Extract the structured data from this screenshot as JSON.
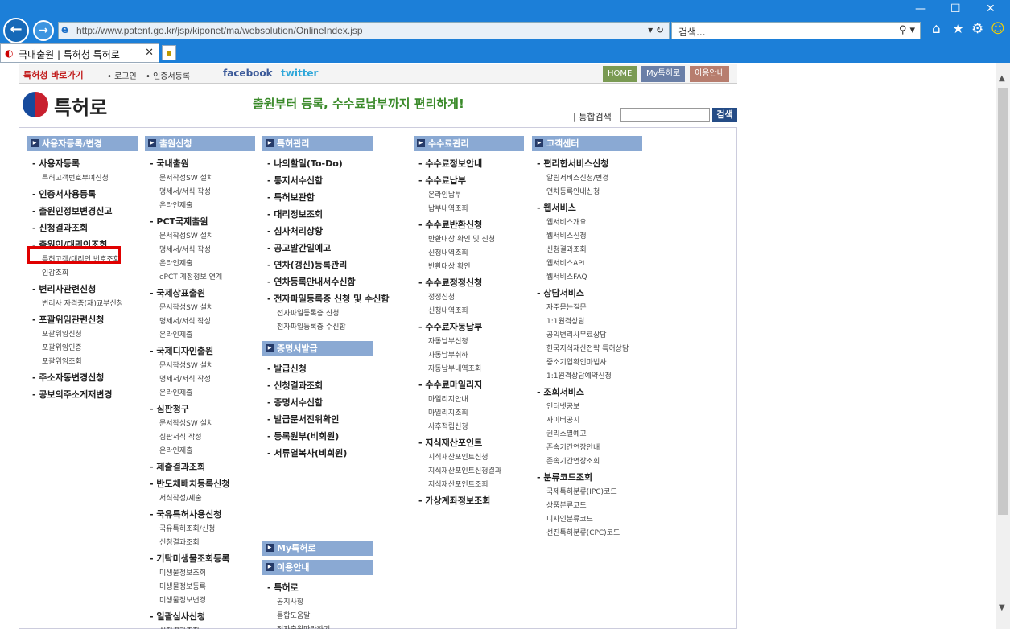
{
  "browser": {
    "address": "http://www.patent.go.kr/jsp/kiponet/ma/websolution/OnlineIndex.jsp",
    "search_placeholder": "검색...",
    "tab_title": "국내출원 | 특허청 특허로"
  },
  "topbar": {
    "shortcut": "특허청 바로가기",
    "login": "로그인",
    "cert": "인증서등록",
    "facebook": "facebook",
    "twitter": "twitter",
    "home_btn": "HOME",
    "my_btn": "My특허로",
    "info_btn": "이용안내"
  },
  "header": {
    "logo": "특허로",
    "slogan": "출원부터 등록, 수수료납부까지 편리하게!",
    "integrated_search": "통합검색",
    "search_btn": "검색"
  },
  "columns": [
    {
      "sections": [
        {
          "title": "사용자등록/변경",
          "items": [
            {
              "label": "사용자등록",
              "sub": [
                "특허고객번호부여신청"
              ]
            },
            {
              "label": "인증서사용등록",
              "sub": []
            },
            {
              "label": "출원인정보변경신고",
              "sub": []
            },
            {
              "label": "신청결과조회",
              "sub": []
            },
            {
              "label": "출원인/대리인조회",
              "sub": [
                "특허고객/대리인 번호조회",
                "인감조회"
              ]
            },
            {
              "label": "변리사관련신청",
              "sub": [
                "변리사 자격증(재)교부신청"
              ]
            },
            {
              "label": "포괄위임관련신청",
              "sub": [
                "포괄위임신청",
                "포괄위임인증",
                "포괄위임조회"
              ]
            },
            {
              "label": "주소자동변경신청",
              "sub": []
            },
            {
              "label": "공보의주소게재변경",
              "sub": []
            }
          ]
        }
      ]
    },
    {
      "sections": [
        {
          "title": "출원신청",
          "items": [
            {
              "label": "국내출원",
              "sub": [
                "문서작성SW 설치",
                "명세서/서식 작성",
                "온라인제출"
              ]
            },
            {
              "label": "PCT국제출원",
              "sub": [
                "문서작성SW 설치",
                "명세서/서식 작성",
                "온라인제출",
                "ePCT 계정정보 연계"
              ]
            },
            {
              "label": "국제상표출원",
              "sub": [
                "문서작성SW 설치",
                "명세서/서식 작성",
                "온라인제출"
              ]
            },
            {
              "label": "국제디자인출원",
              "sub": [
                "문서작성SW 설치",
                "명세서/서식 작성",
                "온라인제출"
              ]
            },
            {
              "label": "심판청구",
              "sub": [
                "문서작성SW 설치",
                "심판서식 작성",
                "온라인제출"
              ]
            },
            {
              "label": "제출결과조회",
              "sub": []
            },
            {
              "label": "반도체배치등록신청",
              "sub": [
                "서식작성/제출"
              ]
            },
            {
              "label": "국유특허사용신청",
              "sub": [
                "국유특허조회/신청",
                "신청결과조회"
              ]
            },
            {
              "label": "기탁미생물조회등록",
              "sub": [
                "미생물정보조회",
                "미생물정보등록",
                "미생물정보변경"
              ]
            },
            {
              "label": "일괄심사신청",
              "sub": [
                "신청결과조회"
              ]
            }
          ]
        }
      ]
    },
    {
      "sections": [
        {
          "title": "특허관리",
          "items": [
            {
              "label": "나의할일(To-Do)",
              "sub": []
            },
            {
              "label": "통지서수신함",
              "sub": []
            },
            {
              "label": "특허보관함",
              "sub": []
            },
            {
              "label": "대리정보조회",
              "sub": []
            },
            {
              "label": "심사처리상황",
              "sub": []
            },
            {
              "label": "공고발간일예고",
              "sub": []
            },
            {
              "label": "연차(갱신)등록관리",
              "sub": []
            },
            {
              "label": "연차등록안내서수신함",
              "sub": []
            },
            {
              "label": "전자파일등록증 신청 및 수신함",
              "sub": [
                "전자파일등록증 신청",
                "전자파일등록증 수신함"
              ]
            }
          ]
        },
        {
          "title": "증명서발급",
          "items": [
            {
              "label": "발급신청",
              "sub": []
            },
            {
              "label": "신청결과조회",
              "sub": []
            },
            {
              "label": "증명서수신함",
              "sub": []
            },
            {
              "label": "발급문서진위확인",
              "sub": []
            },
            {
              "label": "등록원부(비회원)",
              "sub": []
            },
            {
              "label": "서류열복사(비회원)",
              "sub": []
            }
          ]
        },
        {
          "title": "My특허로",
          "items": []
        },
        {
          "title": "이용안내",
          "items": [
            {
              "label": "특허로",
              "sub": [
                "공지사항",
                "통합도움말",
                "전자출원따라하기"
              ]
            }
          ]
        }
      ]
    },
    {
      "sections": [
        {
          "title": "수수료관리",
          "items": [
            {
              "label": "수수료정보안내",
              "sub": []
            },
            {
              "label": "수수료납부",
              "sub": [
                "온라인납부",
                "납부내역조회"
              ]
            },
            {
              "label": "수수료반환신청",
              "sub": [
                "반환대상 확인 및 신청",
                "신청내역조회",
                "반환대상 확인"
              ]
            },
            {
              "label": "수수료정정신청",
              "sub": [
                "정정신청",
                "신청내역조회"
              ]
            },
            {
              "label": "수수료자동납부",
              "sub": [
                "자동납부신청",
                "자동납부취하",
                "자동납부내역조회"
              ]
            },
            {
              "label": "수수료마일리지",
              "sub": [
                "마일리지안내",
                "마일리지조회",
                "사후적립신청"
              ]
            },
            {
              "label": "지식재산포인트",
              "sub": [
                "지식재산포인트신청",
                "지식재산포인트신청결과",
                "지식재산포인트조회"
              ]
            },
            {
              "label": "가상계좌정보조회",
              "sub": []
            }
          ]
        }
      ]
    },
    {
      "sections": [
        {
          "title": "고객센터",
          "items": [
            {
              "label": "편리한서비스신청",
              "sub": [
                "알림서비스신청/변경",
                "연차등록안내신청"
              ]
            },
            {
              "label": "웹서비스",
              "sub": [
                "웹서비스개요",
                "웹서비스신청",
                "신청결과조회",
                "웹서비스API",
                "웹서비스FAQ"
              ]
            },
            {
              "label": "상담서비스",
              "sub": [
                "자주묻는질문",
                "1:1원격상담",
                "공익변리사무료상담",
                "한국지식재산전략 특허상담",
                "중소기업확인마법사",
                "1:1원격상담예약신청"
              ]
            },
            {
              "label": "조회서비스",
              "sub": [
                "인터넷공보",
                "사이버공지",
                "권리소멸예고",
                "존속기간연장안내",
                "존속기간연장조회"
              ]
            },
            {
              "label": "분류코드조회",
              "sub": [
                "국제특허분류(IPC)코드",
                "상품분류코드",
                "디자인분류코드",
                "선진특허분류(CPC)코드"
              ]
            }
          ]
        }
      ]
    }
  ]
}
